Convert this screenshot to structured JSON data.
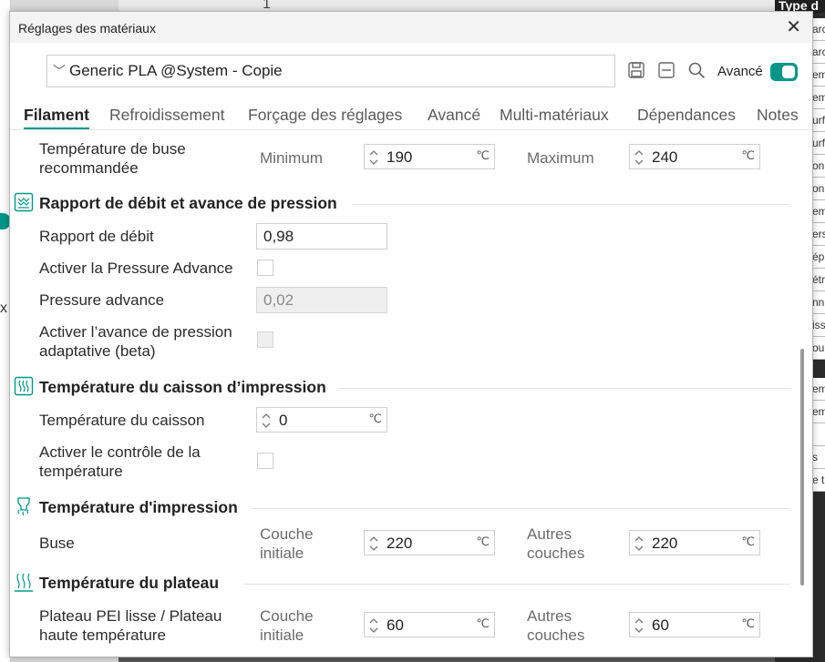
{
  "background": {
    "top_number": "1",
    "right_panel_header": "Type d",
    "right_panel_cells": [
      "arc",
      "arc",
      "em",
      "em",
      "urf",
      "urf",
      "on",
      "on",
      "em",
      "ers",
      "ép",
      "étr",
      "nn",
      "iss",
      "ou"
    ],
    "right_panel_cells_2": [
      "em",
      "em",
      "",
      "s",
      "e t"
    ],
    "left_fragment": "x"
  },
  "dialog": {
    "title": "Réglages des matériaux",
    "close_glyph": "✕",
    "preset_chevron": "﹀",
    "preset_name": "Generic PLA @System - Copie",
    "advanced_label": "Avancé",
    "advanced_on": true,
    "tabs": [
      "Filament",
      "Refroidissement",
      "Forçage des réglages",
      "Avancé",
      "Multi-matériaux",
      "Dépendances",
      "Notes"
    ],
    "active_tab": "Filament"
  },
  "content": {
    "nozzle_recommended": {
      "label_line1": "Température de buse",
      "label_line2": "recommandée",
      "min_label": "Minimum",
      "min_value": "190",
      "max_label": "Maximum",
      "max_value": "240",
      "unit": "℃"
    },
    "flow_section": {
      "title": "Rapport de débit et avance de pression",
      "icon": "flow-ratio-icon",
      "flow_ratio_label": "Rapport de débit",
      "flow_ratio_value": "0,98",
      "enable_pa_label": "Activer la Pressure Advance",
      "enable_pa_checked": false,
      "pa_label": "Pressure advance",
      "pa_value": "0,02",
      "adaptive_label_line1": "Activer l’avance de pression",
      "adaptive_label_line2": "adaptative (beta)",
      "adaptive_checked": false
    },
    "chamber_section": {
      "title": "Température du caisson d’impression",
      "icon": "chamber-heat-icon",
      "chamber_label": "Température du caisson",
      "chamber_value": "0",
      "unit": "℃",
      "control_label_line1": "Activer le contrôle de la",
      "control_label_line2": "température",
      "control_checked": false
    },
    "print_temp_section": {
      "title": "Température d'impression",
      "icon": "nozzle-heat-icon",
      "nozzle_label": "Buse",
      "initial_label_line1": "Couche",
      "initial_label_line2": "initiale",
      "initial_value": "220",
      "other_label_line1": "Autres",
      "other_label_line2": "couches",
      "other_value": "220",
      "unit": "℃"
    },
    "bed_section": {
      "title": "Température du plateau",
      "icon": "bed-heat-icon",
      "plate_label_line1": "Plateau PEI lisse / Plateau",
      "plate_label_line2": "haute température",
      "initial_label_line1": "Couche",
      "initial_label_line2": "initiale",
      "initial_value": "60",
      "other_label_line1": "Autres",
      "other_label_line2": "couches",
      "other_value": "60",
      "unit": "℃"
    }
  },
  "colors": {
    "accent": "#009688",
    "text": "#262626",
    "muted": "#6b6b6b",
    "border": "#cfcfcf"
  }
}
